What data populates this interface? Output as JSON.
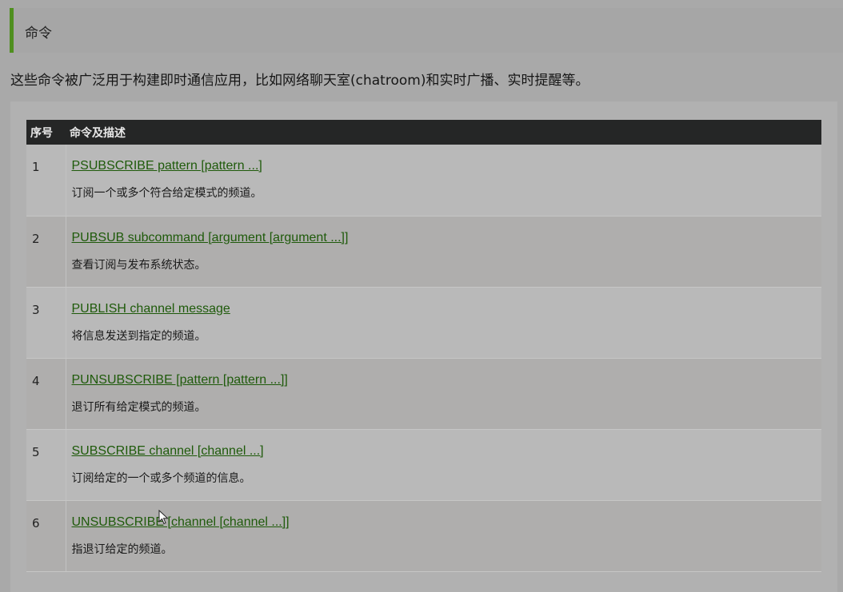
{
  "section": {
    "title": "命令"
  },
  "intro": "这些命令被广泛用于构建即时通信应用，比如网络聊天室(chatroom)和实时广播、实时提醒等。",
  "table": {
    "headers": [
      "序号",
      "命令及描述"
    ],
    "rows": [
      {
        "no": "1",
        "command": "PSUBSCRIBE pattern [pattern ...]",
        "desc": "订阅一个或多个符合给定模式的频道。"
      },
      {
        "no": "2",
        "command": "PUBSUB subcommand [argument [argument ...]]",
        "desc": "查看订阅与发布系统状态。"
      },
      {
        "no": "3",
        "command": "PUBLISH channel message",
        "desc": "将信息发送到指定的频道。"
      },
      {
        "no": "4",
        "command": "PUNSUBSCRIBE [pattern [pattern ...]]",
        "desc": "退订所有给定模式的频道。"
      },
      {
        "no": "5",
        "command": "SUBSCRIBE channel [channel ...]",
        "desc": "订阅给定的一个或多个频道的信息。"
      },
      {
        "no": "6",
        "command": "UNSUBSCRIBE [channel [channel ...]]",
        "desc": "指退订给定的频道。"
      }
    ]
  },
  "colors": {
    "accent": "#4f8f1f",
    "link": "#1e5a0a",
    "header_bg": "#252626"
  }
}
